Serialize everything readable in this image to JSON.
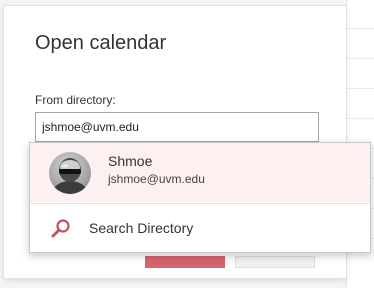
{
  "dialog": {
    "title": "Open calendar",
    "directory_label": "From directory:",
    "directory_input_value": "jshmoe@uvm.edu"
  },
  "suggestions": {
    "person": {
      "name": "Shmoe",
      "email": "jshmoe@uvm.edu",
      "icon": "user-avatar-icon"
    },
    "search": {
      "label": "Search Directory",
      "icon": "search-icon"
    }
  },
  "colors": {
    "accent": "#c8505c",
    "highlight": "#fcf0f1",
    "primary_button": "#d6636d"
  }
}
